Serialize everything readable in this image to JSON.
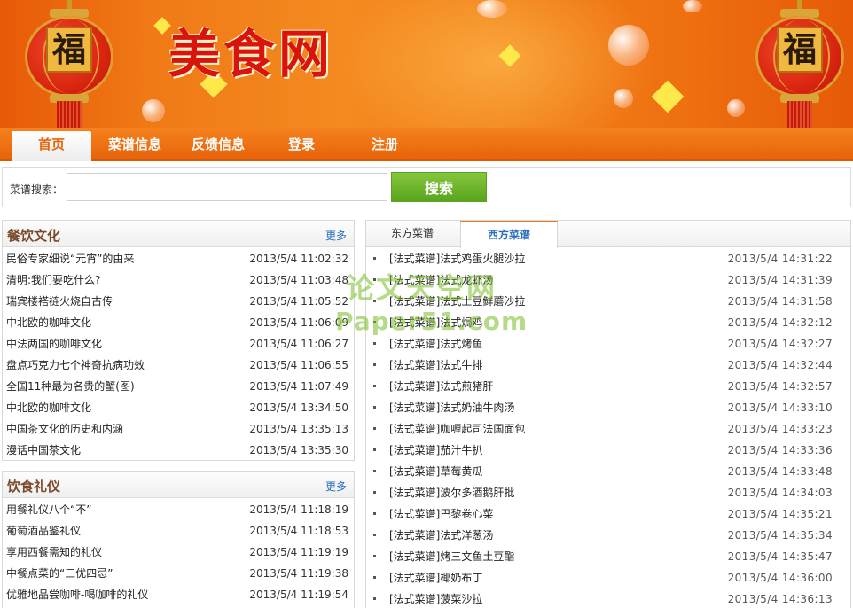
{
  "banner": {
    "logo_text": "美食网",
    "lantern_char": "福"
  },
  "nav": {
    "items": [
      {
        "label": "首页",
        "active": true
      },
      {
        "label": "菜谱信息",
        "active": false
      },
      {
        "label": "反馈信息",
        "active": false
      },
      {
        "label": "登录",
        "active": false
      },
      {
        "label": "注册",
        "active": false
      }
    ]
  },
  "search": {
    "label": "菜谱搜索：",
    "value": "",
    "button_label": "搜索"
  },
  "culture": {
    "title": "餐饮文化",
    "more": "更多",
    "items": [
      {
        "title": "民俗专家细说“元宵”的由来",
        "date": "2013/5/4 11:02:32"
      },
      {
        "title": "清明:我们要吃什么?",
        "date": "2013/5/4 11:03:48"
      },
      {
        "title": "瑞宾楼褡裢火烧自古传",
        "date": "2013/5/4 11:05:52"
      },
      {
        "title": "中北欧的咖啡文化",
        "date": "2013/5/4 11:06:09"
      },
      {
        "title": "中法两国的咖啡文化",
        "date": "2013/5/4 11:06:27"
      },
      {
        "title": "盘点巧克力七个神奇抗病功效",
        "date": "2013/5/4 11:06:55"
      },
      {
        "title": "全国11种最为名贵的蟹(图)",
        "date": "2013/5/4 11:07:49"
      },
      {
        "title": "中北欧的咖啡文化",
        "date": "2013/5/4 13:34:50"
      },
      {
        "title": "中国茶文化的历史和内涵",
        "date": "2013/5/4 13:35:13"
      },
      {
        "title": "漫话中国茶文化",
        "date": "2013/5/4 13:35:30"
      }
    ]
  },
  "etiquette": {
    "title": "饮食礼仪",
    "more": "更多",
    "items": [
      {
        "title": "用餐礼仪八个“不”",
        "date": "2013/5/4 11:18:19"
      },
      {
        "title": "葡萄酒品鉴礼仪",
        "date": "2013/5/4 11:18:53"
      },
      {
        "title": "享用西餐需知的礼仪",
        "date": "2013/5/4 11:19:19"
      },
      {
        "title": "中餐点菜的“三优四忌”",
        "date": "2013/5/4 11:19:38"
      },
      {
        "title": "优雅地品尝咖啡-喝咖啡的礼仪",
        "date": "2013/5/4 11:19:54"
      }
    ]
  },
  "recipes": {
    "tabs": [
      {
        "label": "东方菜谱",
        "active": false
      },
      {
        "label": "西方菜谱",
        "active": true
      }
    ],
    "items": [
      {
        "title": "[法式菜谱]法式鸡蛋火腿沙拉",
        "date": "2013/5/4 14:31:22"
      },
      {
        "title": "[法式菜谱]法式龙虾汤",
        "date": "2013/5/4 14:31:39"
      },
      {
        "title": "[法式菜谱]法式土豆鲜蘑沙拉",
        "date": "2013/5/4 14:31:58"
      },
      {
        "title": "[法式菜谱]法式焗鸡",
        "date": "2013/5/4 14:32:12"
      },
      {
        "title": "[法式菜谱]法式烤鱼",
        "date": "2013/5/4 14:32:27"
      },
      {
        "title": "[法式菜谱]法式牛排",
        "date": "2013/5/4 14:32:44"
      },
      {
        "title": "[法式菜谱]法式煎猪肝",
        "date": "2013/5/4 14:32:57"
      },
      {
        "title": "[法式菜谱]法式奶油牛肉汤",
        "date": "2013/5/4 14:33:10"
      },
      {
        "title": "[法式菜谱]咖喱起司法国面包",
        "date": "2013/5/4 14:33:23"
      },
      {
        "title": "[法式菜谱]茄汁牛扒",
        "date": "2013/5/4 14:33:36"
      },
      {
        "title": "[法式菜谱]草莓黄瓜",
        "date": "2013/5/4 14:33:48"
      },
      {
        "title": "[法式菜谱]波尔多酒鹅肝批",
        "date": "2013/5/4 14:34:03"
      },
      {
        "title": "[法式菜谱]巴黎卷心菜",
        "date": "2013/5/4 14:35:21"
      },
      {
        "title": "[法式菜谱]法式洋葱汤",
        "date": "2013/5/4 14:35:34"
      },
      {
        "title": "[法式菜谱]烤三文鱼土豆酯",
        "date": "2013/5/4 14:35:47"
      },
      {
        "title": "[法式菜谱]椰奶布丁",
        "date": "2013/5/4 14:36:00"
      },
      {
        "title": "[法式菜谱]菠菜沙拉",
        "date": "2013/5/4 14:36:13"
      }
    ]
  },
  "watermark": {
    "cn": "论文天空网",
    "en": "Paper51.com"
  },
  "colors": {
    "brand_orange": "#f07a16",
    "logo_red": "#d8140c",
    "search_green": "#6ab42a",
    "more_link": "#2a6ebf"
  }
}
